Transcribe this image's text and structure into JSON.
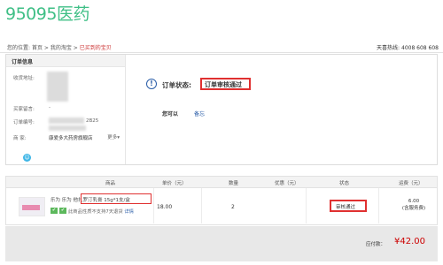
{
  "brand": {
    "logo": "95095医药",
    "logo_color": "#3fbf86"
  },
  "breadcrumb": {
    "prefix": "您的位置:",
    "items": [
      "首页",
      "我的淘宝",
      "已买到的宝贝"
    ],
    "separator": ">"
  },
  "hotline": {
    "label": "天喜热线:",
    "number": "4008 608 608"
  },
  "order_info": {
    "header": "订单信息",
    "fields": [
      {
        "label": "收货地址:",
        "value": ""
      },
      {
        "label": "买家留言:",
        "value": "-"
      },
      {
        "label": "订单编号:",
        "value": "2B25"
      },
      {
        "label": "商    家:",
        "value": "康爱多大药房旗舰店"
      }
    ],
    "more": "更多▾",
    "wangwang_icon": "wangwang-chat-icon"
  },
  "order_status": {
    "icon": "info-icon",
    "label": "订单状态:",
    "value": "订单审核通过",
    "can_do_label": "您可以",
    "remark_link": "备忘"
  },
  "table": {
    "headers": [
      "商品",
      "单价（元）",
      "数量",
      "优惠（元）",
      "状态",
      "运费（元）"
    ],
    "rows": [
      {
        "title_prefix": "乐为 乐为",
        "title_highlight": "他扎罗汀乳膏 15g*1支/盒",
        "note": "此商品性质不支持7天退货",
        "detail_link": "详情",
        "badges": [
          "✔",
          "✔"
        ],
        "price": "18.00",
        "quantity": "2",
        "discount": "",
        "status": "审核通过",
        "shipping": "6.00",
        "shipping_note": "(含服务费)"
      }
    ]
  },
  "total": {
    "label": "应付款：",
    "amount": "¥42.00",
    "color": "#cc0000"
  }
}
